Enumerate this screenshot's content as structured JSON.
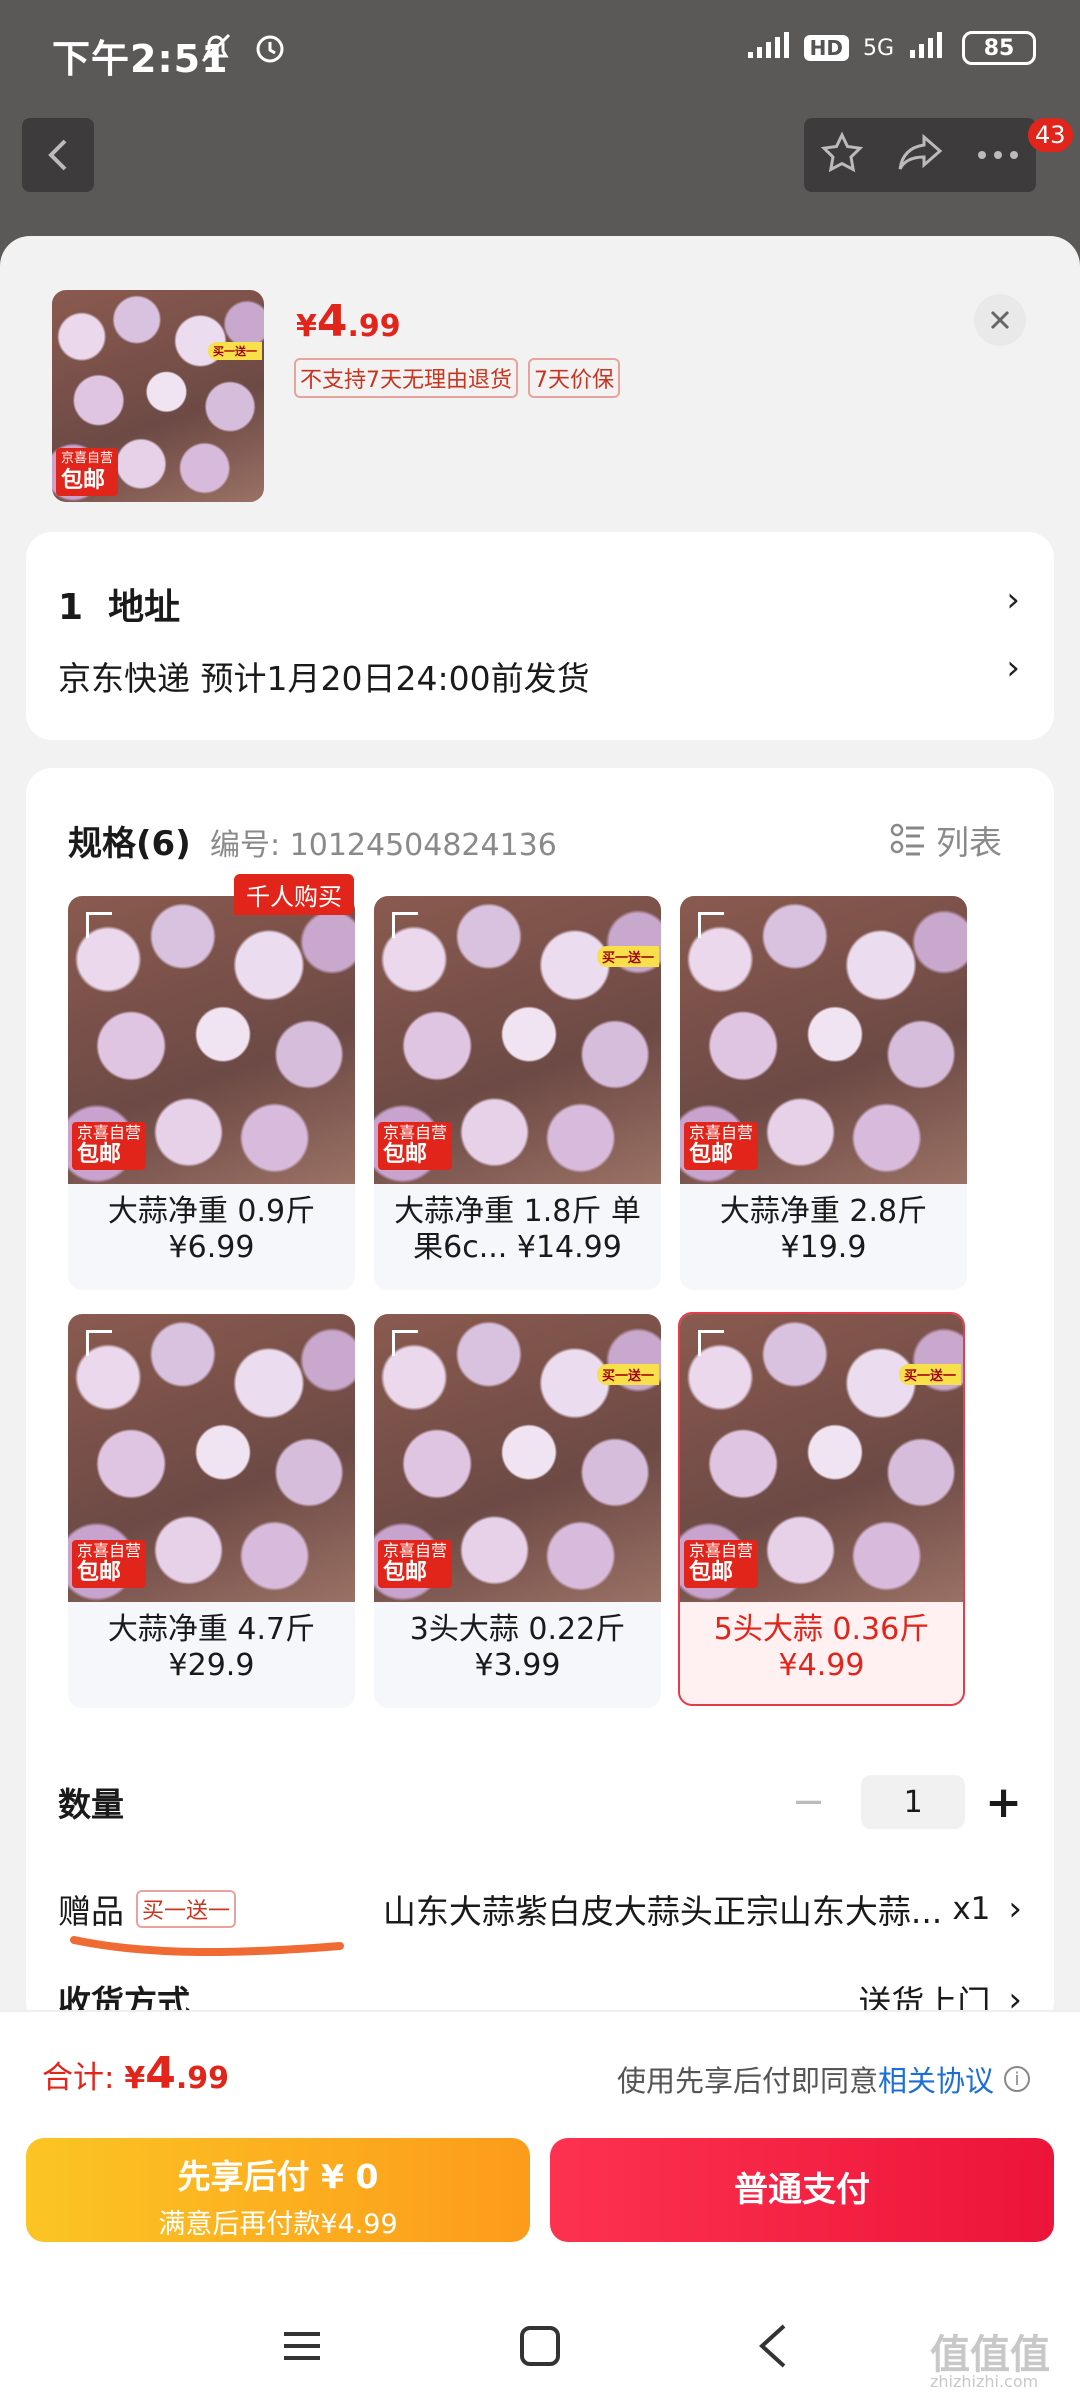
{
  "status": {
    "time": "下午2:51",
    "hd": "HD",
    "net": "5G",
    "battery": "85"
  },
  "nav": {
    "badge": "43"
  },
  "product": {
    "price_symbol": "¥",
    "price_int": "4",
    "price_dec": ".99",
    "tags": [
      "不支持7天无理由退货",
      "7天价保"
    ],
    "img_tag_top": "买一送一",
    "img_tag_jd": "京喜自营",
    "img_tag_free": "包邮"
  },
  "address": {
    "title": "1  地址",
    "delivery": "京东快递 预计1月20日24:00前发货"
  },
  "specs": {
    "title": "规格(6)",
    "code": "编号: 10124504824136",
    "list_label": "列表",
    "hot_tag": "千人购买",
    "items": [
      {
        "name": "大蒜净重 0.9斤\n¥6.99"
      },
      {
        "name": "大蒜净重 1.8斤 单果6c...  ¥14.99"
      },
      {
        "name": "大蒜净重 2.8斤\n¥19.9"
      },
      {
        "name": "大蒜净重 4.7斤\n¥29.9"
      },
      {
        "name": "3头大蒜 0.22斤\n¥3.99"
      },
      {
        "name": "5头大蒜 0.36斤\n¥4.99"
      }
    ],
    "jd": "京喜自营",
    "free": "包邮",
    "buyone": "买一送一"
  },
  "quantity": {
    "label": "数量",
    "minus": "−",
    "value": "1",
    "plus": "+"
  },
  "gift": {
    "label": "赠品",
    "tag": "买一送一",
    "text": "山东大蒜紫白皮大蒜头正宗山东大蒜...",
    "qty": "x1"
  },
  "shipping": {
    "label": "收货方式",
    "value": "送货上门"
  },
  "total": {
    "label": "合计: ",
    "symbol": "¥",
    "int": "4",
    "dec": ".99",
    "agree": "使用先享后付即同意",
    "agree_link": "相关协议"
  },
  "buttons": {
    "later_title": "先享后付 ¥ 0",
    "later_sub": "满意后再付款¥4.99",
    "pay": "普通支付"
  },
  "watermark": {
    "text": "值值值",
    "url": "zhizhizhi.com"
  }
}
